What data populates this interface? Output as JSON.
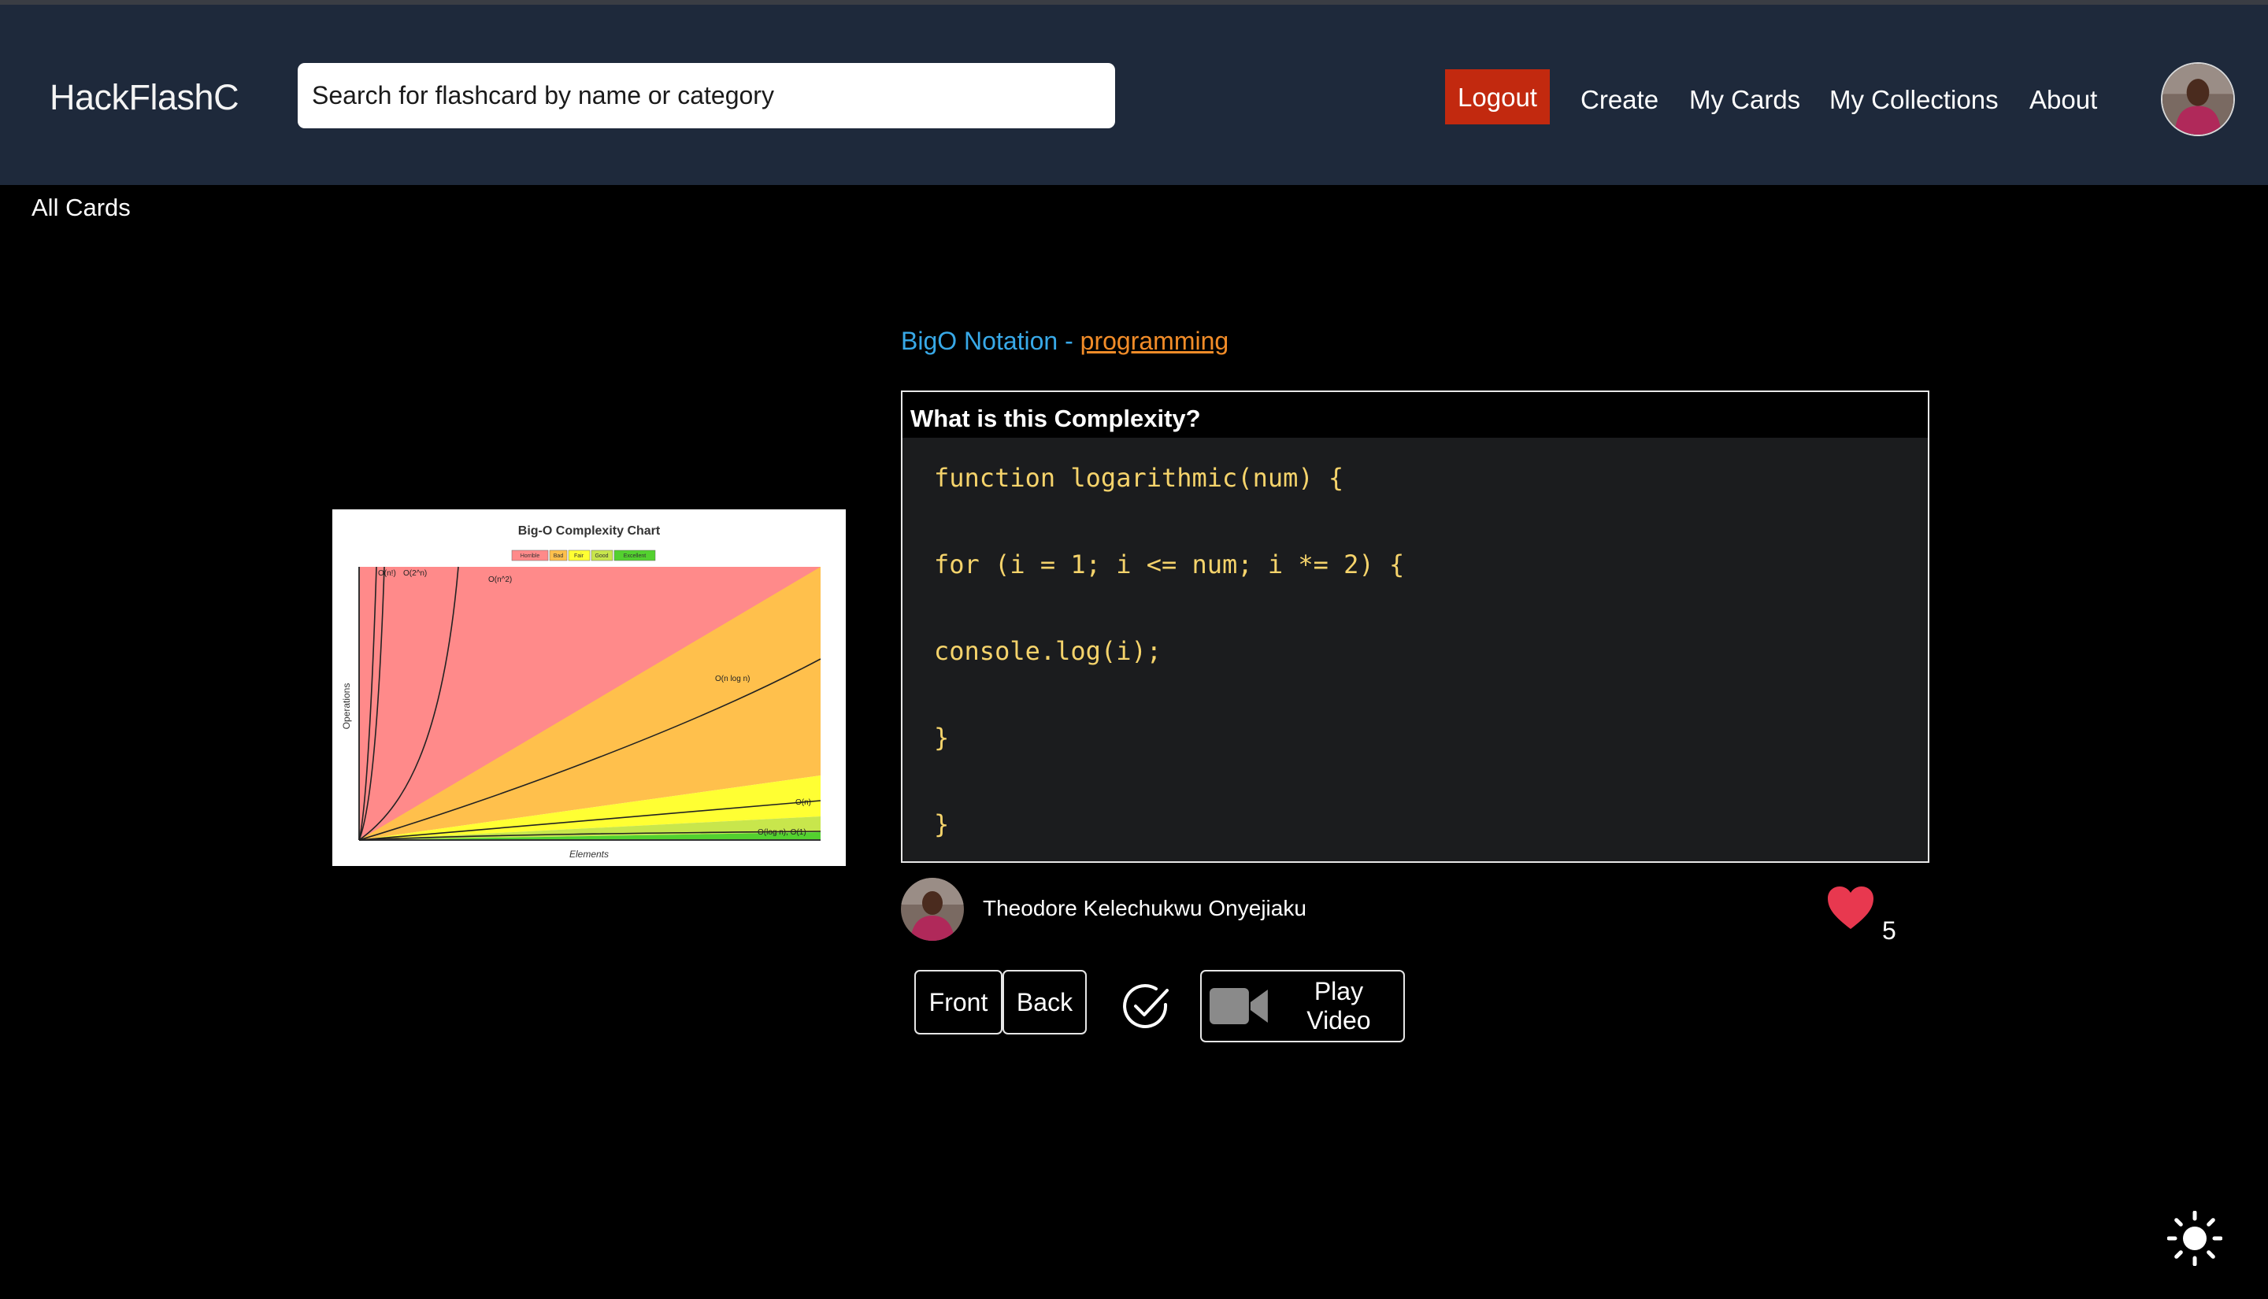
{
  "app": {
    "brand": "HackFlashC"
  },
  "search": {
    "placeholder": "Search for flashcard by name or category"
  },
  "nav": {
    "logout": "Logout",
    "create": "Create",
    "my_cards": "My Cards",
    "my_collections": "My Collections",
    "about": "About"
  },
  "page": {
    "section_label": "All Cards"
  },
  "card": {
    "topic": "BigO Notation",
    "separator": " - ",
    "category": "programming",
    "question": "What is this Complexity?",
    "code_lines": [
      "function logarithmic(num) {",
      "for (i = 1; i <= num; i *= 2) {",
      "console.log(i);",
      "}",
      "}"
    ],
    "author": "Theodore Kelechukwu Onyejiaku",
    "likes": "5",
    "buttons": {
      "front": "Front",
      "back": "Back",
      "play_video": "Play Video"
    }
  },
  "chart_image": {
    "title": "Big-O Complexity Chart",
    "legend": [
      "Horrible",
      "Bad",
      "Fair",
      "Good",
      "Excellent"
    ],
    "ylabel": "Operations",
    "xlabel": "Elements",
    "curve_labels": [
      "O(n!)",
      "O(2^n)",
      "O(n^2)",
      "O(n log n)",
      "O(n)",
      "O(log n), O(1)"
    ]
  },
  "colors": {
    "navbar_bg": "#1e293b",
    "logout_bg": "#c2290f",
    "topic": "#38a9e8",
    "category": "#f28c28",
    "code_text": "#f5d36b",
    "code_bg": "#1b1c1e",
    "heart": "#e8384f"
  },
  "icons": {
    "check": "check-circle-icon",
    "video": "video-camera-icon",
    "theme": "sun-icon",
    "like": "heart-icon"
  }
}
